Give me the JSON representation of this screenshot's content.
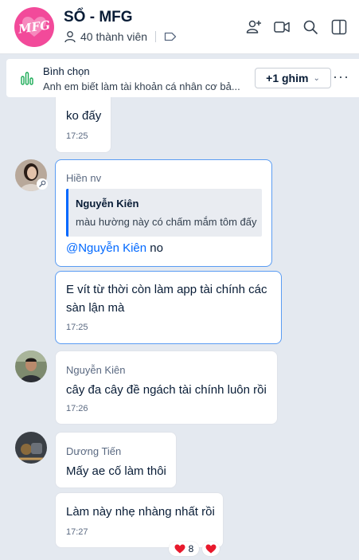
{
  "header": {
    "group_name": "SỔ - MFG",
    "member_count": "40 thành viên",
    "avatar_logo": "MFG"
  },
  "pinned": {
    "title": "Bình chọn",
    "subtitle": "Anh em biết làm tài khoản cá nhân cơ bả...",
    "ghim_label": "+1 ghim",
    "more_label": "···"
  },
  "messages": [
    {
      "text": "ko đấy",
      "time": "17:25"
    },
    {
      "sender": "Hiền nv",
      "quote_name": "Nguyễn Kiên",
      "quote_text": "màu hường này có chấm mắm tôm đấy",
      "mention": "@Nguyễn Kiên",
      "text": " no"
    },
    {
      "text_line1": "E vít từ thời còn làm app tài chính các",
      "text_line2": "sàn lận mà",
      "time": "17:25"
    },
    {
      "sender": "Nguyễn Kiên",
      "text": "cây đa cây đề ngách tài chính luôn rồi",
      "time": "17:26"
    },
    {
      "sender": "Dương Tiến",
      "text": "Mấy ae cố làm thôi"
    },
    {
      "text": "Làm này nhẹ nhàng nhất rồi",
      "time": "17:27"
    }
  ],
  "reactions": {
    "heart_count": "8"
  },
  "colors": {
    "accent": "#0068ff",
    "background": "#e4e9f0",
    "selected_border": "#5a9cf3",
    "heart": "#e8192c"
  }
}
